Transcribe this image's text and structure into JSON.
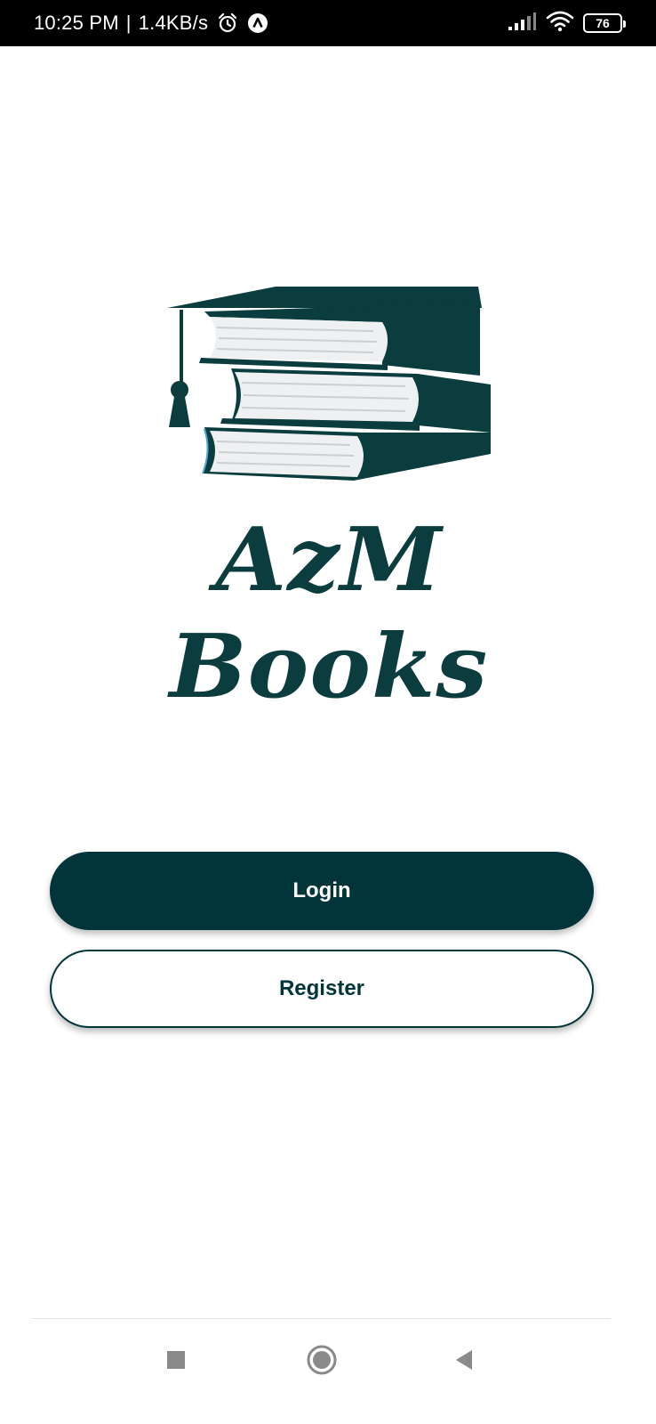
{
  "status_bar": {
    "time": "10:25 PM",
    "separator": "|",
    "speed": "1.4KB/s",
    "battery_level": "76",
    "icons": [
      "alarm-icon",
      "notification-a-icon",
      "signal-icon",
      "wifi-icon",
      "battery-icon"
    ]
  },
  "logo": {
    "brand_text": "AzM Books",
    "icon": "books-graduation-cap-icon",
    "color": "#0b3d3f"
  },
  "actions": {
    "login_label": "Login",
    "register_label": "Register"
  },
  "colors": {
    "primary": "#013539",
    "background": "#ffffff"
  },
  "navigation": {
    "icons": [
      "recents-square-icon",
      "home-circle-icon",
      "back-triangle-icon"
    ]
  }
}
